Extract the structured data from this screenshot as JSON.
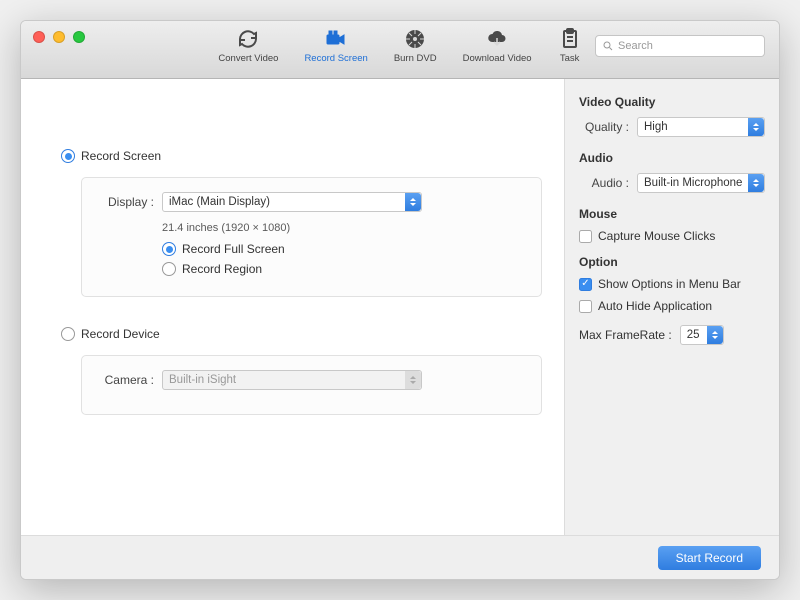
{
  "toolbar": {
    "items": [
      {
        "id": "convert",
        "label": "Convert Video"
      },
      {
        "id": "record",
        "label": "Record Screen"
      },
      {
        "id": "burn",
        "label": "Burn DVD"
      },
      {
        "id": "download",
        "label": "Download Video"
      },
      {
        "id": "task",
        "label": "Task"
      }
    ],
    "active": "record"
  },
  "search": {
    "placeholder": "Search"
  },
  "main": {
    "recordScreen": {
      "label": "Record Screen",
      "selected": true,
      "display": {
        "label": "Display :",
        "value": "iMac (Main Display)",
        "sub": "21.4 inches (1920 × 1080)"
      },
      "mode": {
        "full": "Record Full Screen",
        "region": "Record Region",
        "selected": "full"
      }
    },
    "recordDevice": {
      "label": "Record Device",
      "selected": false,
      "camera": {
        "label": "Camera :",
        "value": "Built-in iSight"
      }
    }
  },
  "sidebar": {
    "videoQuality": {
      "title": "Video Quality",
      "quality": {
        "label": "Quality :",
        "value": "High"
      }
    },
    "audio": {
      "title": "Audio",
      "source": {
        "label": "Audio :",
        "value": "Built-in Microphone"
      }
    },
    "mouse": {
      "title": "Mouse",
      "capture": {
        "label": "Capture Mouse Clicks",
        "checked": false
      }
    },
    "option": {
      "title": "Option",
      "menubar": {
        "label": "Show Options in Menu Bar",
        "checked": true
      },
      "autohide": {
        "label": "Auto Hide Application",
        "checked": false
      },
      "framerate": {
        "label": "Max FrameRate :",
        "value": "25"
      }
    }
  },
  "footer": {
    "start": "Start Record"
  }
}
